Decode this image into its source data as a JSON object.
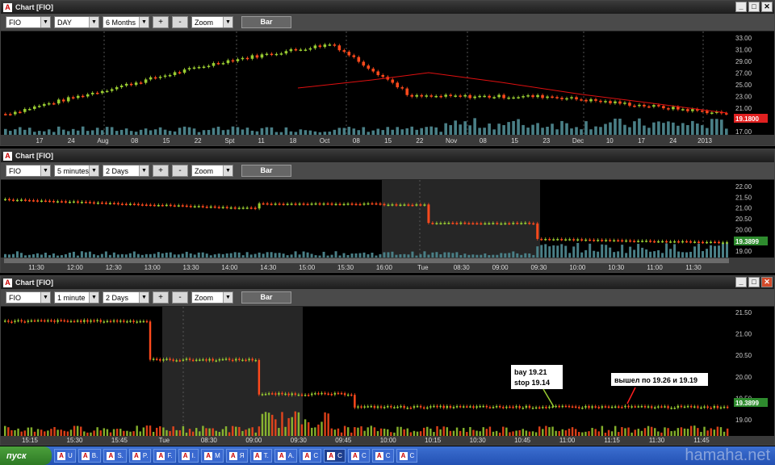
{
  "windows": [
    {
      "title": "Chart [FIO]",
      "ticker": "FIO",
      "interval": "DAY",
      "range": "6 Months",
      "zoom": "Zoom",
      "bar": "Bar",
      "plus": "+",
      "minus": "-",
      "price_labels": [
        "33.00",
        "31.00",
        "29.00",
        "27.00",
        "25.00",
        "23.00",
        "21.00",
        "19.00",
        "17.00"
      ],
      "current_price": "19.1800",
      "time_labels": [
        "17",
        "24",
        "Aug",
        "08",
        "15",
        "22",
        "Spt",
        "11",
        "18",
        "Oct",
        "08",
        "15",
        "22",
        "Nov",
        "08",
        "15",
        "23",
        "Dec",
        "10",
        "17",
        "24",
        "2013"
      ]
    },
    {
      "title": "Chart [FIO]",
      "ticker": "FIO",
      "interval": "5 minutes",
      "range": "2 Days",
      "zoom": "Zoom",
      "bar": "Bar",
      "plus": "+",
      "minus": "-",
      "price_labels": [
        "22.00",
        "21.50",
        "21.00",
        "20.50",
        "20.00",
        "19.50",
        "19.00"
      ],
      "current_price": "19.3899",
      "time_labels": [
        "11:30",
        "12:00",
        "12:30",
        "13:00",
        "13:30",
        "14:00",
        "14:30",
        "15:00",
        "15:30",
        "16:00",
        "Tue",
        "08:30",
        "09:00",
        "09:30",
        "10:00",
        "10:30",
        "11:00",
        "11:30"
      ]
    },
    {
      "title": "Chart [FIO]",
      "ticker": "FIO",
      "interval": "1 minute",
      "range": "2 Days",
      "zoom": "Zoom",
      "bar": "Bar",
      "plus": "+",
      "minus": "-",
      "price_labels": [
        "21.50",
        "21.00",
        "20.50",
        "20.00",
        "19.50",
        "19.00"
      ],
      "current_price": "19.3899",
      "time_labels": [
        "15:15",
        "15:30",
        "15:45",
        "Tue",
        "08:30",
        "09:00",
        "09:30",
        "09:45",
        "10:00",
        "10:15",
        "10:30",
        "10:45",
        "11:00",
        "11:15",
        "11:30",
        "11:45"
      ],
      "note_buy_line1": "bay 19.21",
      "note_buy_line2": "stop 19.14",
      "note_exit": "вышел по 19.26 и 19.19"
    }
  ],
  "taskbar": {
    "start": "пуск",
    "items": [
      "U",
      "B.",
      "S.",
      "P.",
      "F.",
      "I.",
      "M",
      "Я",
      "T.",
      "A.",
      "C",
      "C",
      "C",
      "C",
      "C"
    ],
    "watermark": "hamaha.net"
  },
  "colors": {
    "up": "#9acd32",
    "down": "#ff4a1c",
    "volume": "#4a7f86",
    "ma": "#e01010",
    "grid": "#333333",
    "tag_down": "#e02020",
    "tag_up": "#2e8b2e"
  }
}
